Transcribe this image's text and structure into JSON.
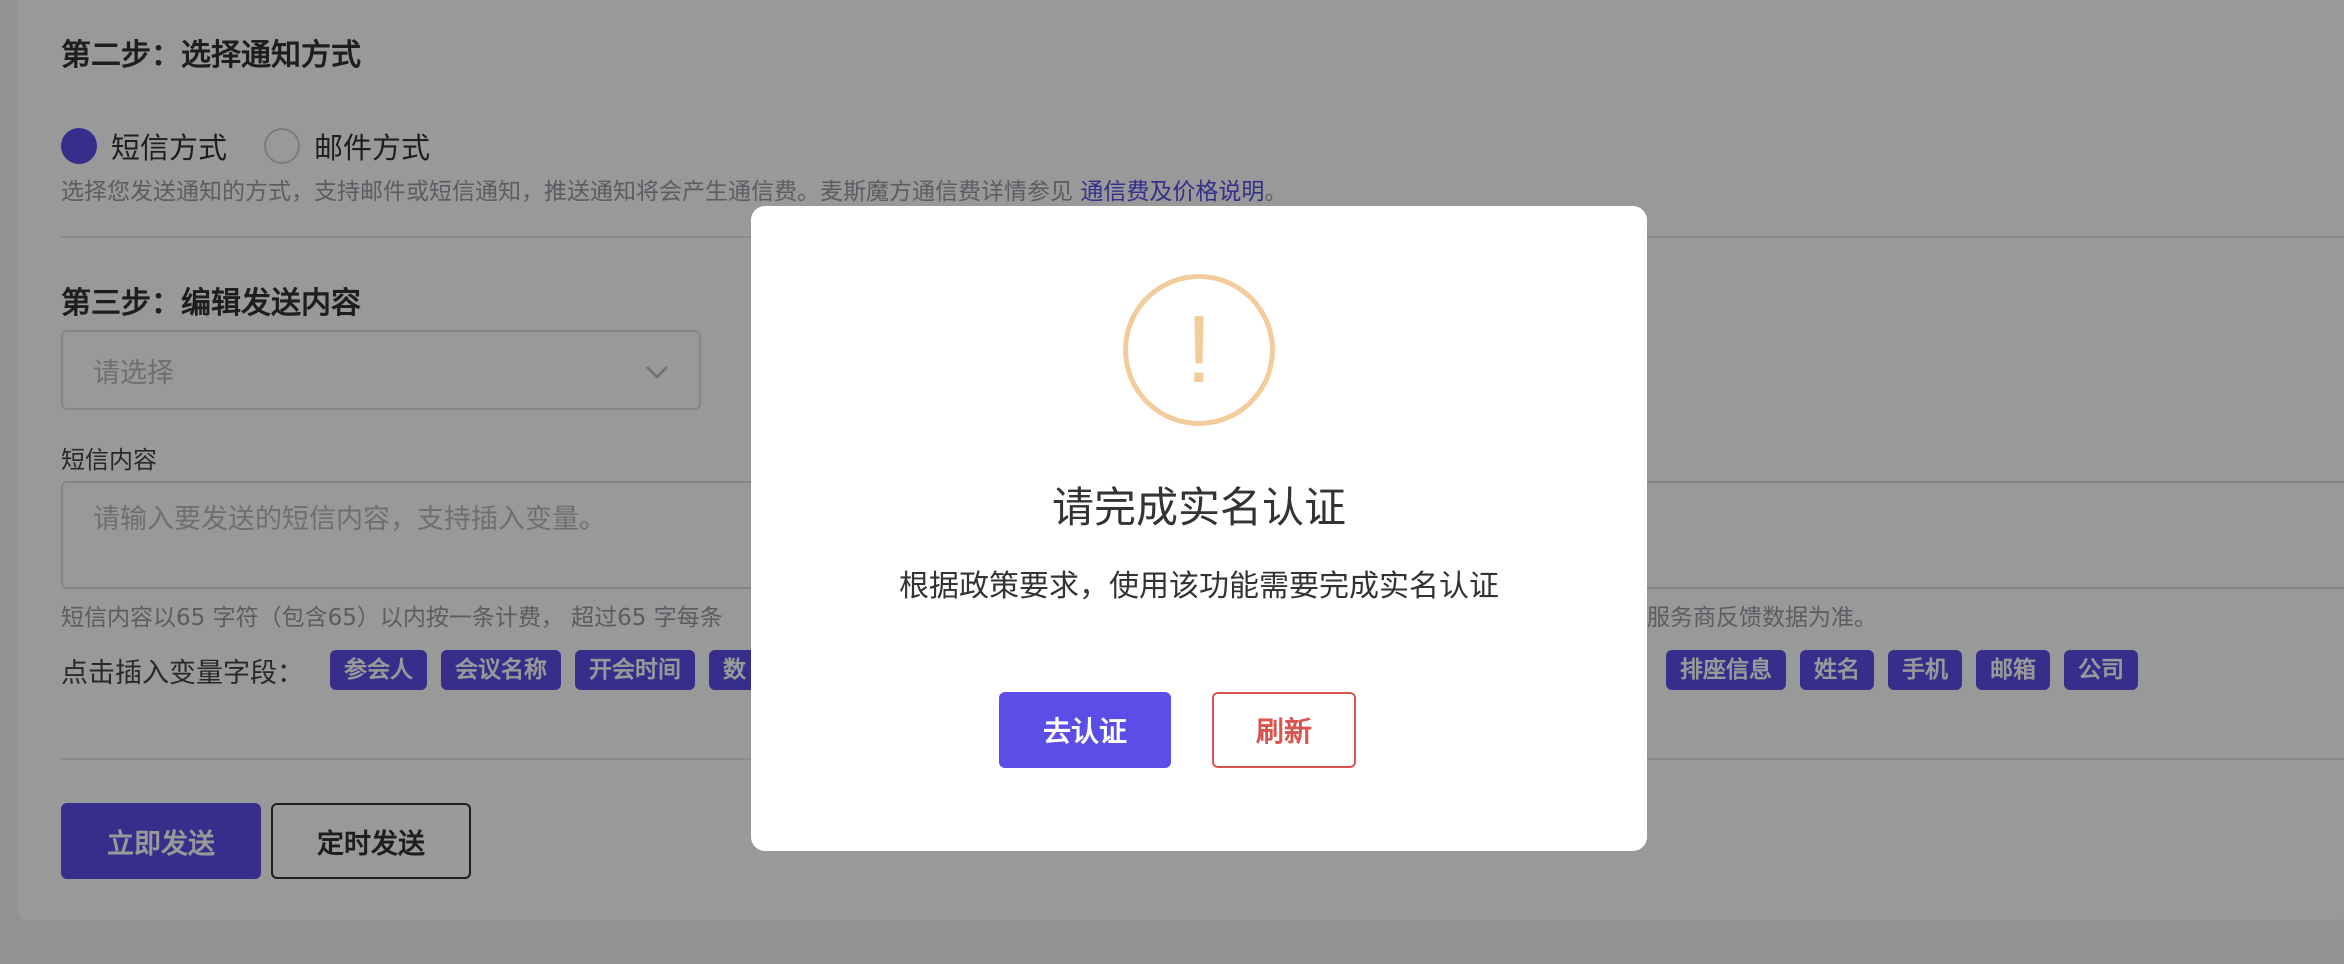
{
  "step2": {
    "title": "第二步：选择通知方式",
    "options": [
      {
        "label": "短信方式",
        "selected": true
      },
      {
        "label": "邮件方式",
        "selected": false
      }
    ],
    "hint_text": "选择您发送通知的方式，支持邮件或短信通知，推送通知将会产生通信费。麦斯魔方通信费详情参见 ",
    "hint_link": "通信费及价格说明",
    "hint_end": "。"
  },
  "step3": {
    "title": "第三步：编辑发送内容",
    "template_select_placeholder": "请选择",
    "sms_label": "短信内容",
    "sms_placeholder": "请输入要发送的短信内容，支持插入变量。",
    "billing_hint_left": "短信内容以65 字符（包含65）以内按一条计费， 超过65 字每条",
    "billing_hint_right": "终服务商反馈数据为准。",
    "vars_label": "点击插入变量字段：",
    "vars_left": [
      "参会人",
      "会议名称",
      "开会时间",
      "数"
    ],
    "vars_right": [
      "排座信息",
      "姓名",
      "手机",
      "邮箱",
      "公司"
    ]
  },
  "actions": {
    "send_now": "立即发送",
    "schedule_send": "定时发送"
  },
  "modal": {
    "icon": "warning-icon",
    "icon_glyph": "!",
    "title": "请完成实名认证",
    "description": "根据政策要求，使用该功能需要完成实名认证",
    "primary_button": "去认证",
    "secondary_button": "刷新"
  },
  "colors": {
    "accent": "#5a4ee6",
    "warning": "#f3cc9d",
    "danger": "#d9534f"
  }
}
